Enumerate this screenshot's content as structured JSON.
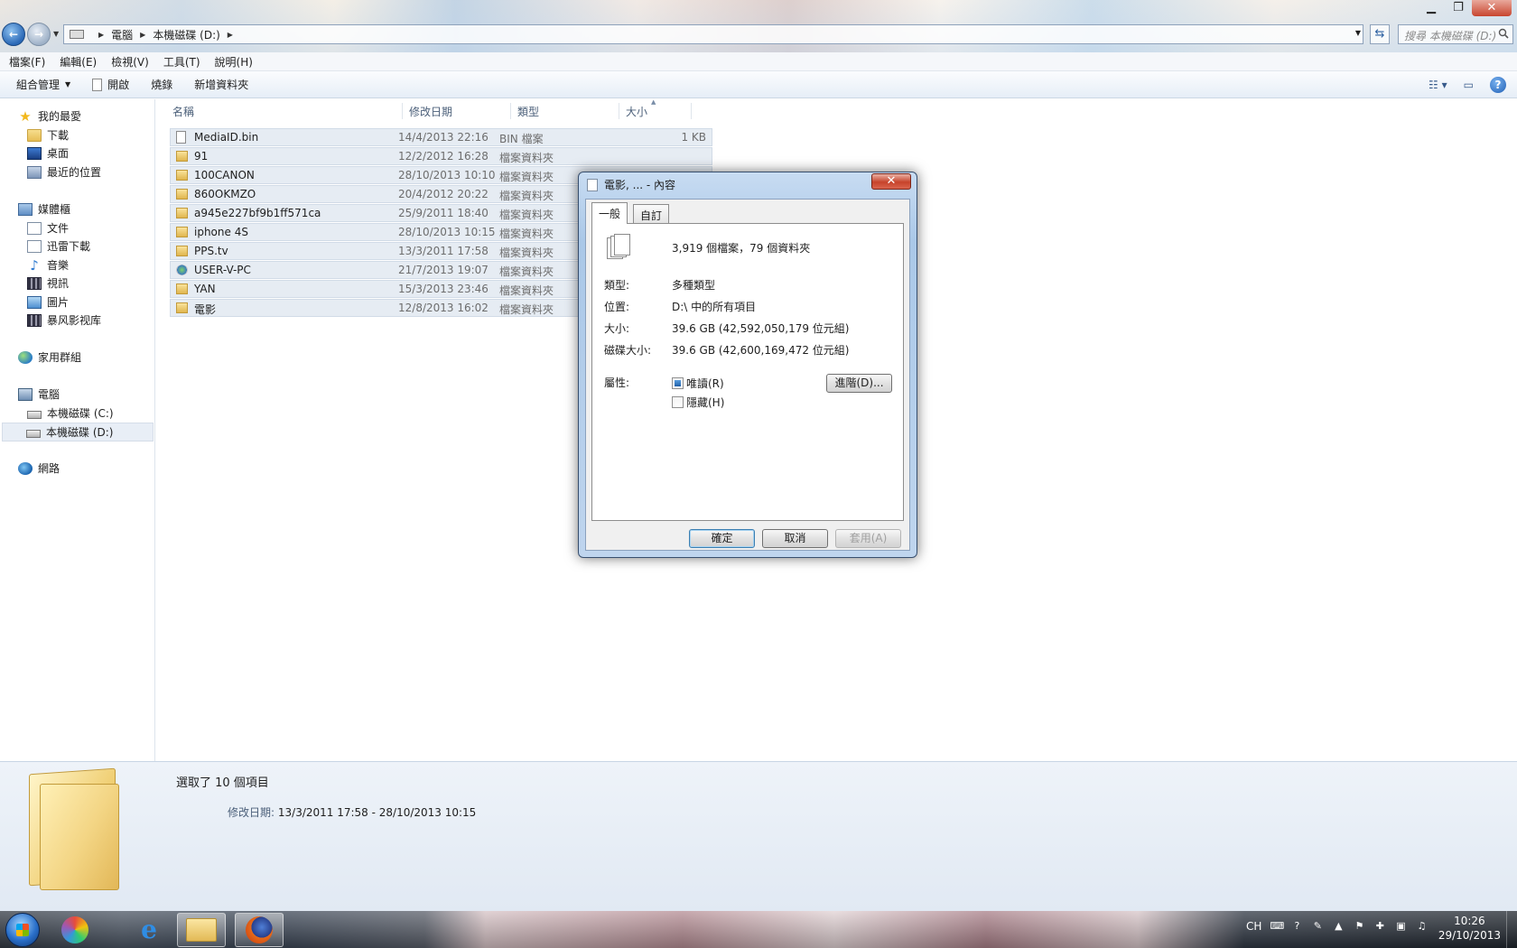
{
  "window": {
    "minimize": "▁",
    "maximize": "❐",
    "close": "✕"
  },
  "address": {
    "crumbs": [
      "電腦",
      "本機磁碟 (D:)"
    ],
    "search_placeholder": "搜尋 本機磁碟 (D:)"
  },
  "menubar": [
    "檔案(F)",
    "編輯(E)",
    "檢視(V)",
    "工具(T)",
    "說明(H)"
  ],
  "toolbar": {
    "organize": "組合管理",
    "open": "開啟",
    "burn": "燒錄",
    "new_folder": "新增資料夾"
  },
  "navpane": {
    "favorites": "我的最愛",
    "downloads": "下載",
    "desktop": "桌面",
    "recent": "最近的位置",
    "libraries": "媒體櫃",
    "documents": "文件",
    "xunlei": "迅雷下載",
    "music": "音樂",
    "videos": "視訊",
    "pictures": "圖片",
    "baofeng": "暴风影视库",
    "homegroup": "家用群組",
    "computer": "電腦",
    "drive_c": "本機磁碟 (C:)",
    "drive_d": "本機磁碟 (D:)",
    "network": "網路"
  },
  "columns": {
    "name": "名稱",
    "modified": "修改日期",
    "type": "類型",
    "size": "大小"
  },
  "files": [
    {
      "name": "MediaID.bin",
      "date": "14/4/2013 22:16",
      "type": "BIN 檔案",
      "size": "1 KB",
      "icon": "file-icon"
    },
    {
      "name": "91",
      "date": "12/2/2012 16:28",
      "type": "檔案資料夾",
      "size": "",
      "icon": "folder-icon"
    },
    {
      "name": "100CANON",
      "date": "28/10/2013 10:10",
      "type": "檔案資料夾",
      "size": "",
      "icon": "folder-icon"
    },
    {
      "name": "860OKMZO",
      "date": "20/4/2012 20:22",
      "type": "檔案資料夾",
      "size": "",
      "icon": "folder-icon"
    },
    {
      "name": "a945e227bf9b1ff571ca",
      "date": "25/9/2011 18:40",
      "type": "檔案資料夾",
      "size": "",
      "icon": "locked-folder-icon"
    },
    {
      "name": "iphone 4S",
      "date": "28/10/2013 10:15",
      "type": "檔案資料夾",
      "size": "",
      "icon": "folder-icon"
    },
    {
      "name": "PPS.tv",
      "date": "13/3/2011 17:58",
      "type": "檔案資料夾",
      "size": "",
      "icon": "folder-icon"
    },
    {
      "name": "USER-V-PC",
      "date": "21/7/2013 19:07",
      "type": "檔案資料夾",
      "size": "",
      "icon": "network-folder-icon"
    },
    {
      "name": "YAN",
      "date": "15/3/2013 23:46",
      "type": "檔案資料夾",
      "size": "",
      "icon": "folder-icon"
    },
    {
      "name": "電影",
      "date": "12/8/2013 16:02",
      "type": "檔案資料夾",
      "size": "",
      "icon": "folder-icon"
    }
  ],
  "details": {
    "selected": "選取了 10 個項目",
    "modified_label": "修改日期:",
    "modified_range": "13/3/2011 17:58 - 28/10/2013 10:15"
  },
  "dialog": {
    "title": "電影, ... - 內容",
    "close": "✕",
    "tabs": [
      "一般",
      "自訂"
    ],
    "summary": "3,919 個檔案，79 個資料夾",
    "type_label": "類型:",
    "type_value": "多種類型",
    "location_label": "位置:",
    "location_value": "D:\\ 中的所有項目",
    "size_label": "大小:",
    "size_value": "39.6 GB (42,592,050,179 位元組)",
    "disk_size_label": "磁碟大小:",
    "disk_size_value": "39.6 GB (42,600,169,472 位元組)",
    "attributes_label": "屬性:",
    "readonly_label": "唯讀(R)",
    "hidden_label": "隱藏(H)",
    "advanced_button": "進階(D)...",
    "ok_button": "確定",
    "cancel_button": "取消",
    "apply_button": "套用(A)"
  },
  "taskbar": {
    "tray_lang": "CH",
    "time": "10:26",
    "date": "29/10/2013"
  }
}
